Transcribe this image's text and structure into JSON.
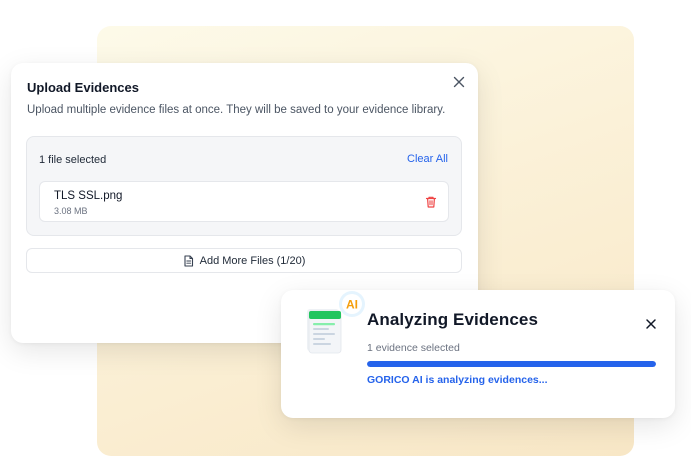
{
  "upload_dialog": {
    "title": "Upload Evidences",
    "description": "Upload multiple evidence files at once. They will be saved to your evidence library.",
    "selected_count_text": "1 file selected",
    "clear_all_label": "Clear All",
    "files": [
      {
        "name": "TLS SSL.png",
        "size": "3.08 MB"
      }
    ],
    "add_more_label": "Add More Files (1/20)",
    "icons": {
      "close": "close-icon",
      "delete": "trash-icon",
      "file": "file-icon"
    }
  },
  "analyze_card": {
    "title": "Analyzing Evidences",
    "subtitle": "1 evidence selected",
    "status_text": "GORICO AI is analyzing evidences...",
    "progress": 1.0,
    "badge_text": "AI",
    "icons": {
      "close": "close-icon",
      "illustration": "ai-document-icon"
    }
  },
  "colors": {
    "accent": "#2563eb",
    "danger": "#ef4444",
    "progress_track": "#e5e7eb",
    "doc_green": "#22c55e"
  }
}
